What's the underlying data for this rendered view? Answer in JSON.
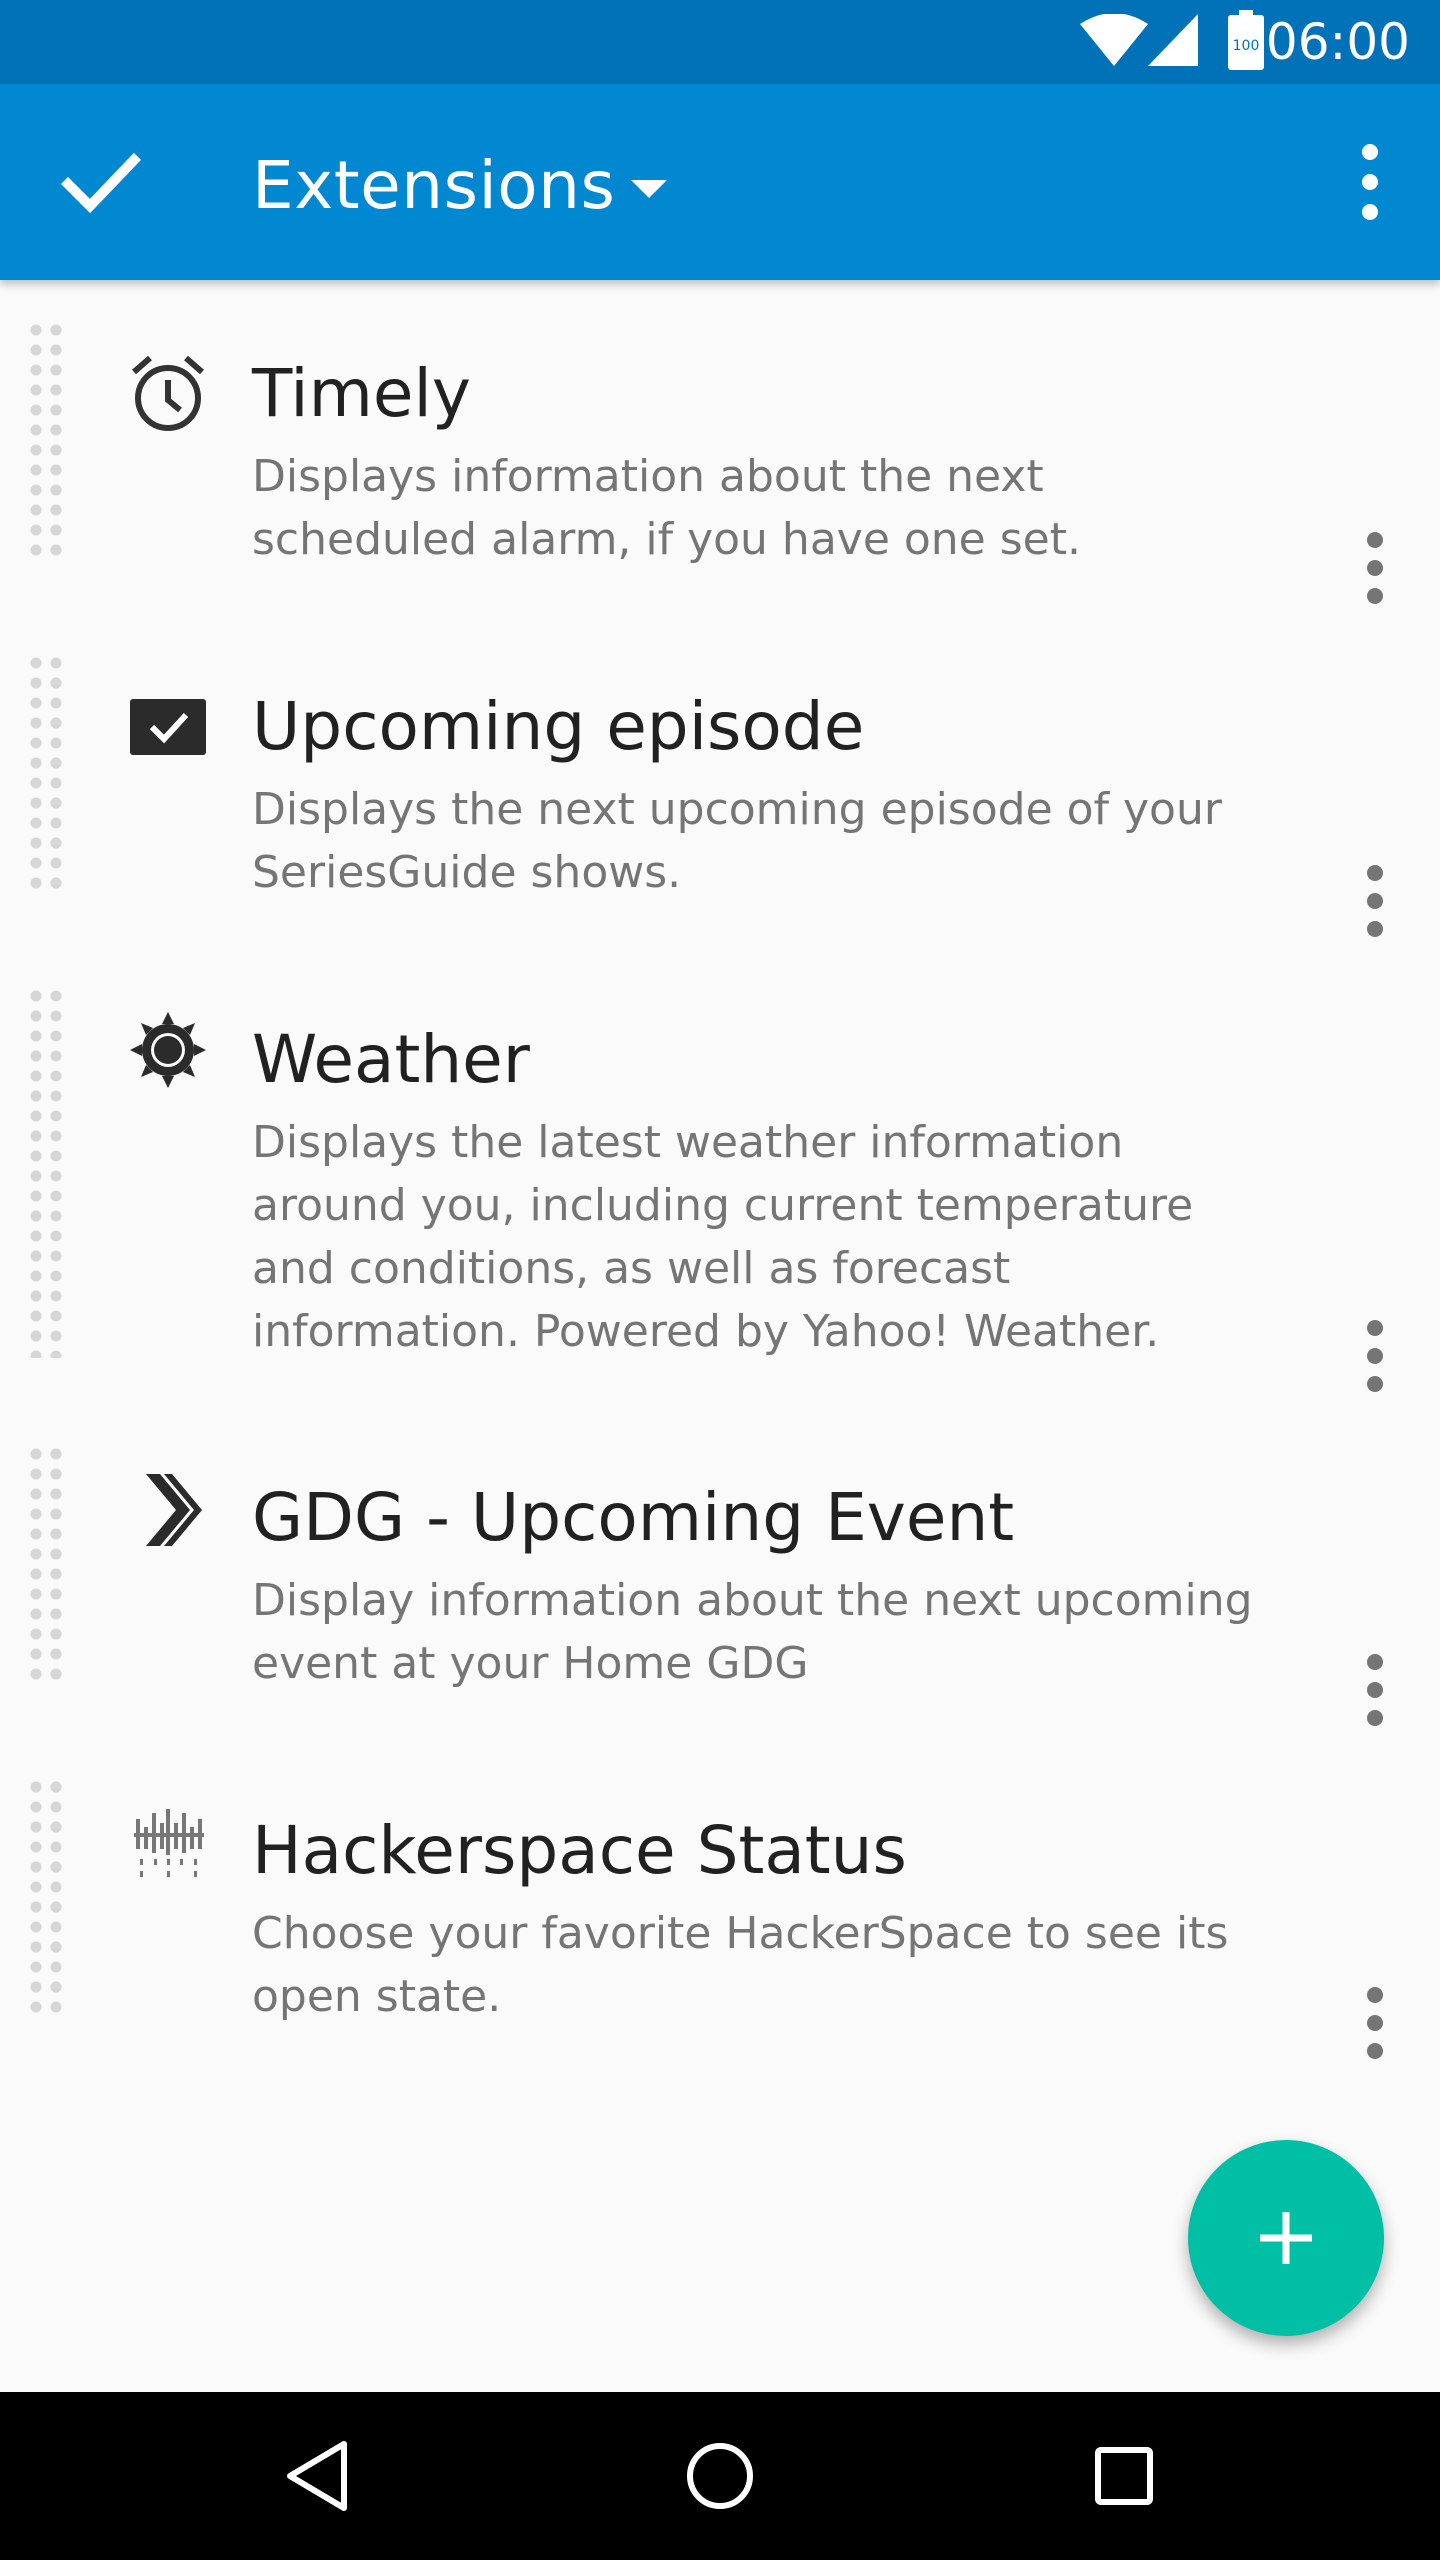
{
  "status_bar": {
    "time": "06:00",
    "battery_label": "100",
    "icons": [
      "wifi-icon",
      "cell-signal-icon",
      "battery-icon"
    ]
  },
  "app_bar": {
    "title": "Extensions",
    "icons": [
      "check-icon",
      "dropdown-caret-icon",
      "overflow-menu-icon"
    ]
  },
  "extensions": [
    {
      "title": "Timely",
      "description": "Displays information about the next scheduled alarm, if you have one set.",
      "icon": "alarm-clock-icon"
    },
    {
      "title": "Upcoming episode",
      "description": "Displays the next upcoming episode of your SeriesGuide shows.",
      "icon": "tv-check-icon"
    },
    {
      "title": "Weather",
      "description": "Displays the latest weather information around you, including current temperature and conditions, as well as forecast information. Powered by Yahoo! Weather.",
      "icon": "sun-icon"
    },
    {
      "title": "GDG - Upcoming Event",
      "description": "Display information about the next upcoming event at your Home GDG",
      "icon": "chevron-logo-icon"
    },
    {
      "title": "Hackerspace Status",
      "description": "Choose your favorite HackerSpace to see its open state.",
      "icon": "hackerspace-logo-icon"
    }
  ],
  "fab": {
    "icon": "plus-icon"
  },
  "nav_bar": {
    "icons": [
      "back-icon",
      "home-icon",
      "recents-icon"
    ]
  },
  "colors": {
    "status_bar": "#0272b8",
    "app_bar": "#0288d1",
    "fab": "#00bfa5",
    "background": "#fafafa"
  }
}
